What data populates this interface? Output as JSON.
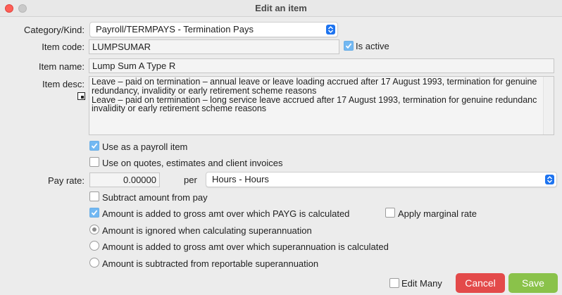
{
  "window": {
    "title": "Edit an item"
  },
  "labels": {
    "category": "Category/Kind:",
    "item_code": "Item code:",
    "item_name": "Item name:",
    "item_desc": "Item desc:",
    "pay_rate": "Pay rate:",
    "per": "per"
  },
  "category_select": {
    "value": "Payroll/TERMPAYS - Termination Pays"
  },
  "item_code": {
    "value": "LUMPSUMAR"
  },
  "is_active": {
    "label": "Is active",
    "checked": true
  },
  "item_name": {
    "value": "Lump Sum A Type R"
  },
  "item_desc": {
    "line1": "Leave – paid on termination – annual leave or leave loading accrued after 17 August 1993, termination for genuine",
    "line2": "redundancy, invalidity or early retirement scheme reasons",
    "line3": "Leave – paid on termination – long service leave accrued after 17 August 1993, termination for genuine redundanc",
    "line4": "invalidity or early retirement scheme reasons"
  },
  "use_as_payroll": {
    "label": "Use as a payroll item",
    "checked": true
  },
  "use_on_quotes": {
    "label": "Use on quotes, estimates and client invoices",
    "checked": false
  },
  "pay_rate": {
    "value": "0.00000"
  },
  "per_select": {
    "value": "Hours - Hours"
  },
  "subtract_amount": {
    "label": "Subtract amount from pay",
    "checked": false
  },
  "added_to_payg": {
    "label": "Amount is added to gross amt over which PAYG is calculated",
    "checked": true
  },
  "apply_marginal": {
    "label": "Apply marginal rate",
    "checked": false
  },
  "super_options": [
    {
      "label": "Amount is ignored when calculating superannuation",
      "selected": true
    },
    {
      "label": "Amount is added to gross amt over which superannuation is calculated",
      "selected": false
    },
    {
      "label": "Amount is subtracted from reportable superannuation",
      "selected": false
    }
  ],
  "edit_many": {
    "label": "Edit Many",
    "checked": false
  },
  "buttons": {
    "cancel": "Cancel",
    "save": "Save"
  },
  "colors": {
    "cancel": "#e34a4a",
    "save": "#8ac24a",
    "stepper": "#1e74f0",
    "checkbox_on": "#72b8f2"
  }
}
